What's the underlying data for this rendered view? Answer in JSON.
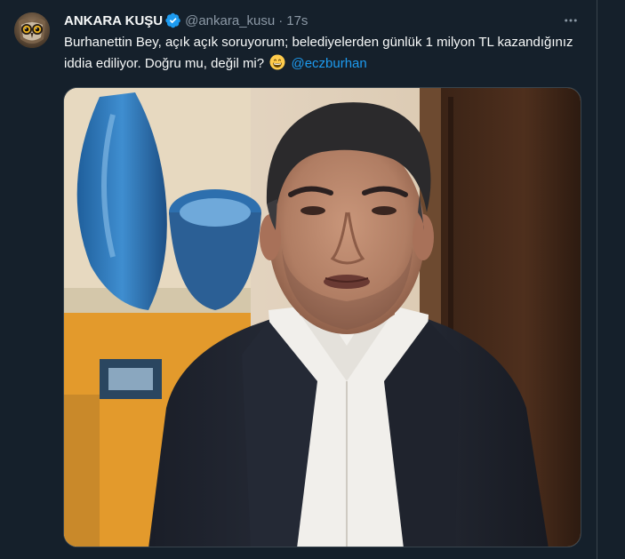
{
  "tweet": {
    "display_name": "ANKARA KUŞU",
    "handle": "@ankara_kusu",
    "separator": "·",
    "timestamp": "17s",
    "text_before_emoji": "Burhanettin Bey, açık açık soruyorum; belediyelerden günlük 1 milyon TL kazandığınız iddia ediliyor. Doğru mu, değil mi?",
    "mention": "@eczburhan",
    "emoji": "grinning-face-with-smiling-eyes",
    "verified_color": "#1d9bf0",
    "link_color": "#1d9bf0",
    "background_color": "#15202b"
  },
  "icons": {
    "verified": "verified-badge-icon",
    "more": "more-horizontal-icon"
  }
}
